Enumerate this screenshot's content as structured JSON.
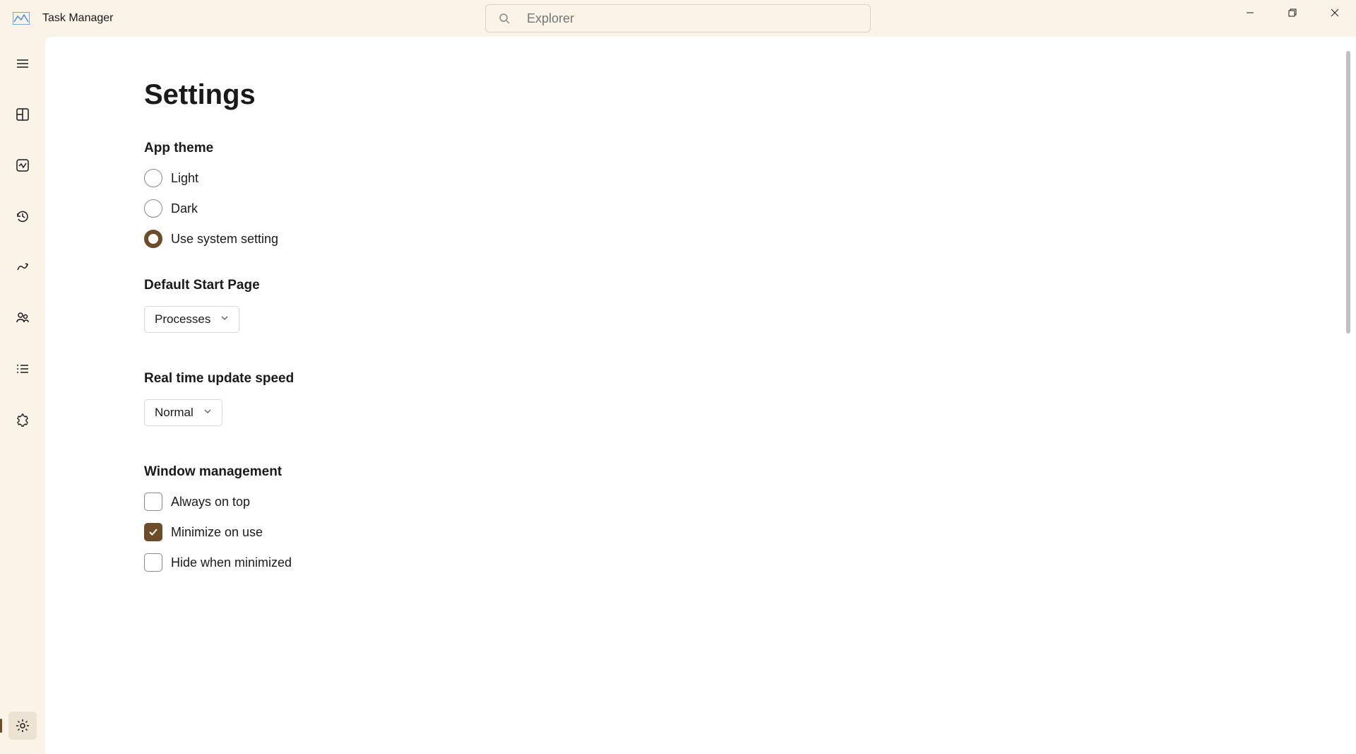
{
  "header": {
    "app_title": "Task Manager",
    "search_placeholder": "Explorer"
  },
  "settings": {
    "page_title": "Settings",
    "sections": {
      "app_theme": {
        "title": "App theme",
        "options": {
          "light": "Light",
          "dark": "Dark",
          "system": "Use system setting"
        },
        "selected": "system"
      },
      "default_start_page": {
        "title": "Default Start Page",
        "value": "Processes"
      },
      "update_speed": {
        "title": "Real time update speed",
        "value": "Normal"
      },
      "window_management": {
        "title": "Window management",
        "options": {
          "always_on_top": "Always on top",
          "minimize_on_use": "Minimize on use",
          "hide_when_minimized": "Hide when minimized"
        },
        "checked": [
          "minimize_on_use"
        ]
      }
    }
  }
}
